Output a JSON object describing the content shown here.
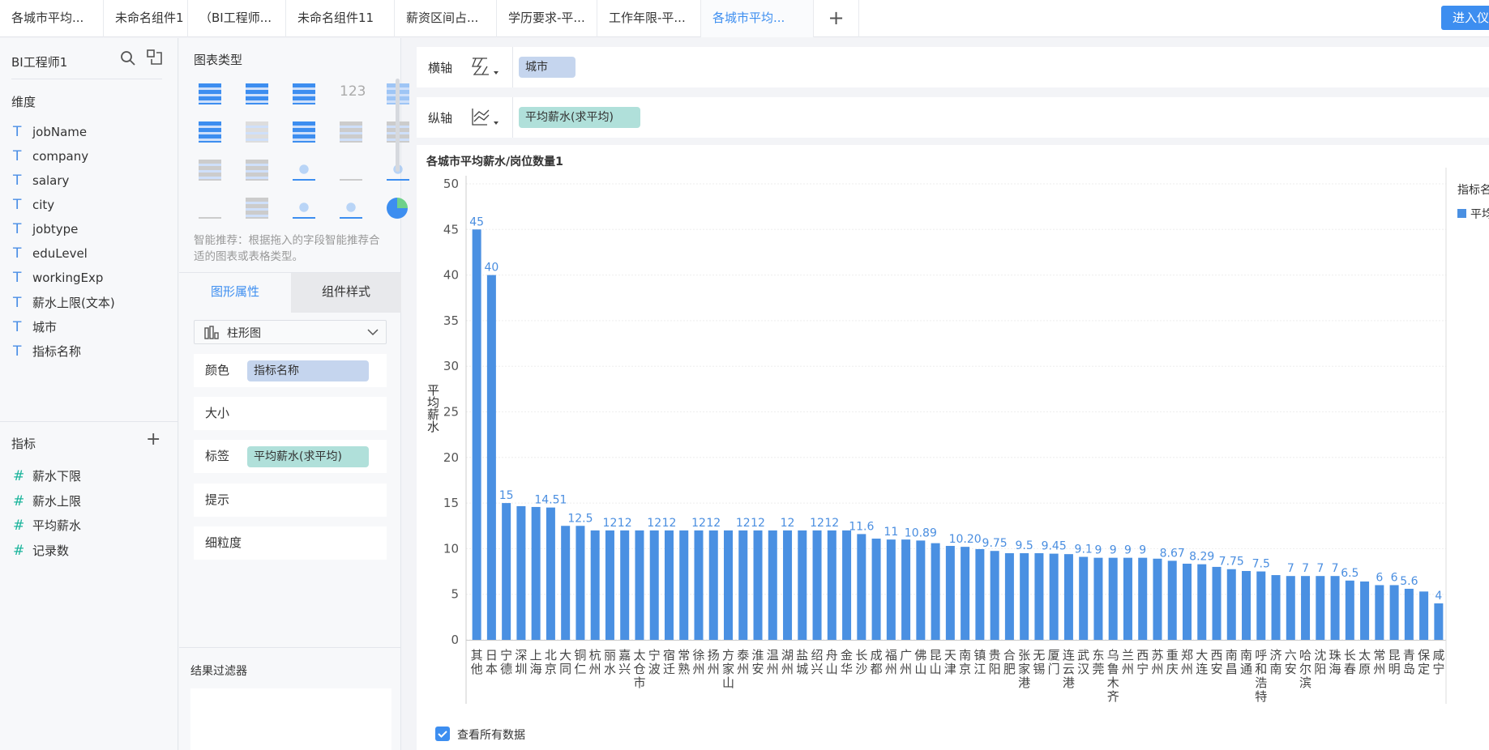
{
  "tabs": [
    "各城市平均...",
    "未命名组件1",
    "（BI工程师...",
    "未命名组件11",
    "薪资区间占...",
    "学历要求-平...",
    "工作年限-平...",
    "各城市平均..."
  ],
  "enter_button": "进入仪",
  "left_panel": {
    "title": "BI工程师1",
    "dimensions_label": "维度",
    "dimensions": [
      "jobName",
      "company",
      "salary",
      "city",
      "jobtype",
      "eduLevel",
      "workingExp",
      "薪水上限(文本)",
      "城市",
      "指标名称"
    ],
    "measures_label": "指标",
    "measures": [
      "薪水下限",
      "薪水上限",
      "平均薪水",
      "记录数"
    ]
  },
  "mid_panel": {
    "chart_type_label": "图表类型",
    "hint": "智能推荐：根据拖入的字段智能推荐合适的图表或表格类型。",
    "tab_graph": "图形属性",
    "tab_style": "组件样式",
    "chart_select": "柱形图",
    "props": {
      "color": "颜色",
      "color_field": "指标名称",
      "size": "大小",
      "label": "标签",
      "label_field": "平均薪水(求平均)",
      "tooltip": "提示",
      "granularity": "细粒度"
    },
    "filter_label": "结果过滤器"
  },
  "axes": {
    "x_label": "横轴",
    "x_field": "城市",
    "y_label": "纵轴",
    "y_field": "平均薪水(求平均)"
  },
  "view_all": "查看所有数据",
  "colors": {
    "bar": "#4a90e2",
    "accent": "#3d8ef0",
    "x_pill": "#c5d5ee",
    "y_pill": "#b0e0da"
  },
  "chart_data": {
    "type": "bar",
    "title": "各城市平均薪水/岗位数量1",
    "ylabel": "平均薪水",
    "ylim": [
      0,
      50
    ],
    "yticks": [
      0,
      5,
      10,
      15,
      20,
      25,
      30,
      35,
      40,
      45,
      50
    ],
    "legend_title": "指标名称",
    "legend_item": "平均薪水",
    "legend_placement": "right",
    "categories": [
      "其他",
      "日本",
      "宁德",
      "深圳",
      "上海",
      "北京",
      "大同",
      "铜仁",
      "杭州",
      "丽水",
      "嘉兴",
      "太仓市",
      "宁波",
      "宿迁",
      "常熟",
      "徐州",
      "扬州",
      "方家山",
      "泰州",
      "淮安",
      "温州",
      "湖州",
      "盐城",
      "绍兴",
      "舟山",
      "金华",
      "长沙",
      "成都",
      "福州",
      "广州",
      "佛山",
      "昆山",
      "天津",
      "南京",
      "镇江",
      "贵阳",
      "合肥",
      "张家港",
      "无锡",
      "厦门",
      "连云港",
      "武汉",
      "东莞",
      "乌鲁木齐",
      "兰州",
      "西宁",
      "苏州",
      "重庆",
      "郑州",
      "大连",
      "西安",
      "南昌",
      "南通",
      "呼和浩特",
      "济南",
      "六安",
      "哈尔滨",
      "沈阳",
      "珠海",
      "长春",
      "太原",
      "常州",
      "昆明",
      "青岛",
      "保定",
      "咸宁"
    ],
    "values": [
      45,
      40,
      15,
      14.66,
      14.57,
      14.51,
      12.5,
      12.5,
      12,
      12,
      12,
      12,
      12,
      12,
      12,
      12,
      12,
      12,
      12,
      12,
      12,
      12,
      12,
      12,
      12,
      12,
      11.6,
      11.1,
      11,
      11,
      10.89,
      10.6,
      10.3,
      10.2,
      9.95,
      9.75,
      9.5,
      9.5,
      9.5,
      9.45,
      9.4,
      9.1,
      9,
      9,
      9,
      9,
      8.9,
      8.67,
      8.35,
      8.29,
      8,
      7.75,
      7.55,
      7.5,
      7.1,
      7,
      7,
      7,
      7,
      6.5,
      6.4,
      6,
      6,
      5.6,
      5.3,
      4
    ],
    "data_labels": [
      "45",
      "40",
      "15",
      "",
      "",
      "14.51",
      "",
      "12.5",
      "",
      "12",
      "12",
      "",
      "12",
      "12",
      "",
      "12",
      "12",
      "",
      "12",
      "12",
      "",
      "12",
      "",
      "12",
      "12",
      "",
      "11.6",
      "",
      "11",
      "",
      "10.89",
      "",
      "",
      "10.20",
      "",
      "9.75",
      "",
      "9.5",
      "",
      "9.45",
      "",
      "9.1",
      "9",
      "9",
      "9",
      "9",
      "",
      "8.67",
      "",
      "8.29",
      "",
      "7.75",
      "",
      "7.5",
      "",
      "7",
      "7",
      "7",
      "7",
      "6.5",
      "",
      "6",
      "6",
      "5.6",
      "",
      "4"
    ]
  }
}
